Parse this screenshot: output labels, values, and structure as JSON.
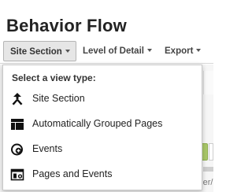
{
  "page": {
    "title": "Behavior Flow"
  },
  "toolbar": {
    "site_section_label": "Site Section",
    "level_of_detail_label": "Level of Detail",
    "export_label": "Export"
  },
  "dropdown": {
    "header": "Select a view type:",
    "items": [
      {
        "label": "Site Section",
        "icon": "split-arrow-icon"
      },
      {
        "label": "Automatically Grouped Pages",
        "icon": "grouped-pages-icon"
      },
      {
        "label": "Events",
        "icon": "events-icon"
      },
      {
        "label": "Pages and Events",
        "icon": "pages-and-events-icon"
      }
    ]
  },
  "background": {
    "url_fragment": "Manager/"
  },
  "colors": {
    "active_button_bg": "#e6e6e6",
    "green_button": "#a9c86a",
    "text": "#222222"
  }
}
